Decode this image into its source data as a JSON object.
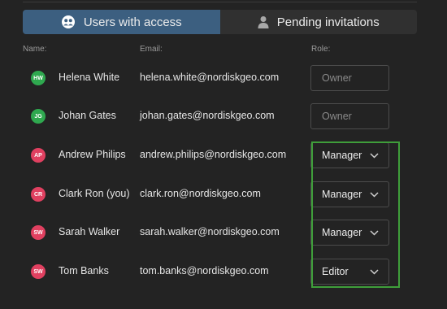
{
  "tabs": [
    {
      "label": "Users with access",
      "active": true
    },
    {
      "label": "Pending invitations",
      "active": false
    }
  ],
  "headers": {
    "name": "Name:",
    "email": "Email:",
    "role": "Role:"
  },
  "users": [
    {
      "initials": "HW",
      "avatar_color": "#2fa84f",
      "name": "Helena White",
      "email": "helena.white@nordiskgeo.com",
      "role": "Owner",
      "editable": false
    },
    {
      "initials": "JG",
      "avatar_color": "#2fa84f",
      "name": "Johan Gates",
      "email": "johan.gates@nordiskgeo.com",
      "role": "Owner",
      "editable": false
    },
    {
      "initials": "AP",
      "avatar_color": "#e04060",
      "name": "Andrew Philips",
      "email": "andrew.philips@nordiskgeo.com",
      "role": "Manager",
      "editable": true
    },
    {
      "initials": "CR",
      "avatar_color": "#e04060",
      "name": "Clark Ron (you)",
      "email": "clark.ron@nordiskgeo.com",
      "role": "Manager",
      "editable": true
    },
    {
      "initials": "SW",
      "avatar_color": "#e04060",
      "name": "Sarah Walker",
      "email": "sarah.walker@nordiskgeo.com",
      "role": "Manager",
      "editable": true
    },
    {
      "initials": "SW",
      "avatar_color": "#e04060",
      "name": "Tom Banks",
      "email": "tom.banks@nordiskgeo.com",
      "role": "Editor",
      "editable": true
    }
  ],
  "colors": {
    "active_tab": "#3c5f80",
    "highlight": "#3f9e3a",
    "background": "#232323"
  }
}
